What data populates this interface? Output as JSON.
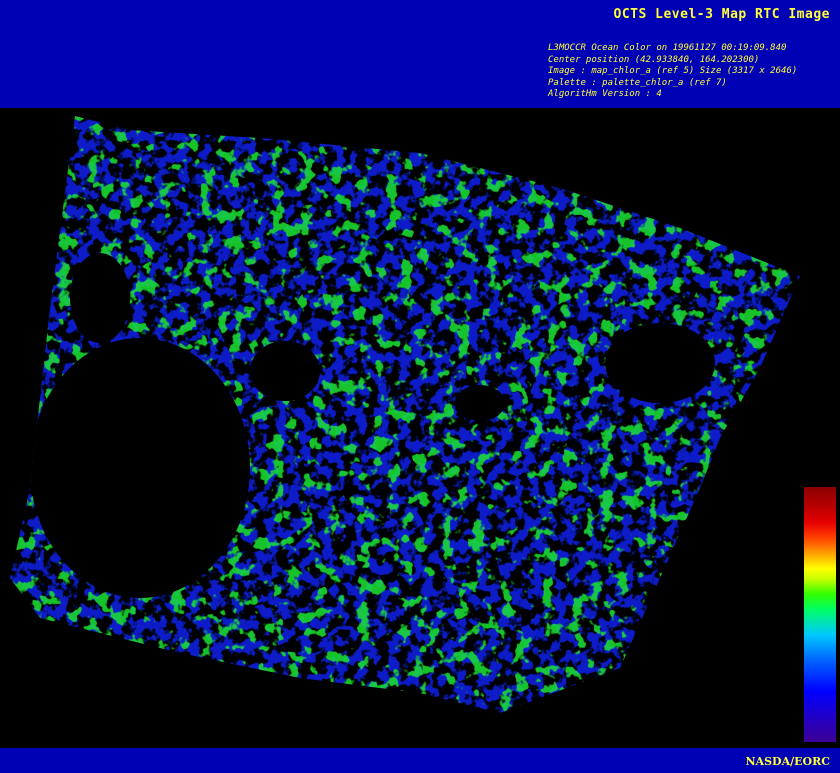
{
  "header": {
    "title": "OCTS Level-3 Map RTC Image",
    "info_lines": [
      "L3MOCCR Ocean Color on 19961127 00:19:09.840",
      "Center position (42.933840, 164.202300)",
      "Image : map_chlor_a (ref 5) Size (3317 x 2646)",
      "Palette : palette_chlor_a (ref 7)",
      "AlgoritHm Version : 4"
    ]
  },
  "footer": {
    "credit": "NASDA/EORC"
  },
  "colors": {
    "frame": "#0000b4",
    "text": "#ffff3c",
    "background": "#000000"
  },
  "colorbar": {
    "palette": "palette_chlor_a",
    "stops": [
      "#3c0096",
      "#0000ff",
      "#00c8ff",
      "#00ff64",
      "#ffff00",
      "#ff4000",
      "#8c0000"
    ]
  }
}
